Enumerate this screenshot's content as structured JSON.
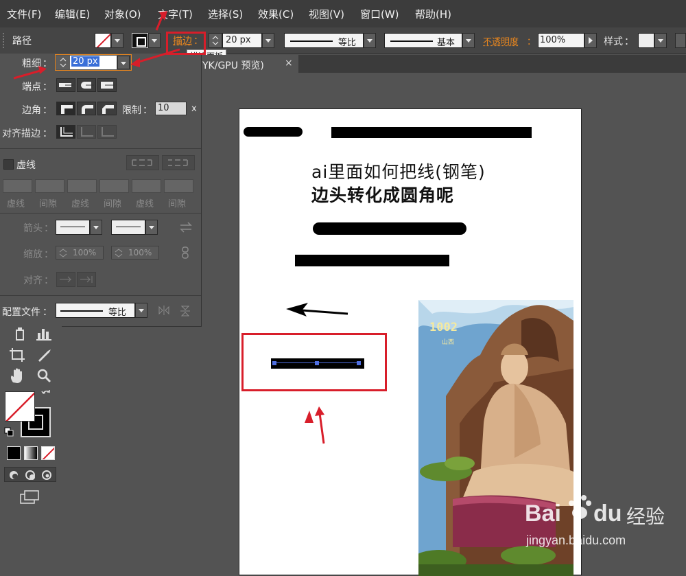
{
  "menubar": {
    "items": [
      "文件(F)",
      "编辑(E)",
      "对象(O)",
      "文字(T)",
      "选择(S)",
      "效果(C)",
      "视图(V)",
      "窗口(W)",
      "帮助(H)"
    ]
  },
  "control_bar": {
    "selection_label": "路径",
    "stroke_link": "描边",
    "stroke_weight": "20 px",
    "profile_label": "等比",
    "brush_label": "基本",
    "opacity_label": "不透明度",
    "opacity_value": "100%",
    "style_label": "样式",
    "tooltip": "描边面板",
    "colon": "："
  },
  "tab": {
    "title": "YK/GPU 预览)",
    "close": "×"
  },
  "stroke_panel": {
    "weight_label": "粗细",
    "weight_value": "20 px",
    "cap_label": "端点",
    "corner_label": "边角",
    "limit_label": "限制",
    "limit_value": "10",
    "limit_unit": "x",
    "align_label": "对齐描边",
    "dashed_label": "虚线",
    "dash_fields": [
      "虚线",
      "间隙",
      "虚线",
      "间隙",
      "虚线",
      "间隙"
    ],
    "arrow_label": "箭头",
    "scale_label": "缩放",
    "scale_start": "100%",
    "scale_end": "100%",
    "align_arrow_label": "对齐",
    "profile_label": "配置文件",
    "profile_value": "等比"
  },
  "artboard": {
    "heading_line1": "ai里面如何把线(钢笔)",
    "heading_line2": "边头转化成圆角呢",
    "poster_text_main": "1002",
    "poster_text_small": "山西"
  },
  "watermark": {
    "brand": "Bai",
    "brand2": "du",
    "cn": "经验",
    "url": "jingyan.baidu.com"
  },
  "colors": {
    "menubar_bg": "#3c3c3c",
    "panel_bg": "#535353",
    "accent_orange": "#e8861e",
    "annotation_red": "#d81e2a",
    "selection_blue": "#3f5fd8"
  }
}
